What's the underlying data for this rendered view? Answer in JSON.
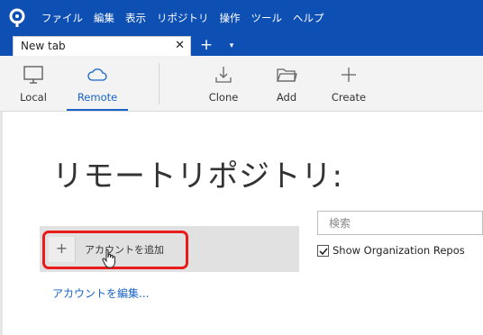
{
  "menubar": {
    "items": [
      "ファイル",
      "編集",
      "表示",
      "リポジトリ",
      "操作",
      "ツール",
      "ヘルプ"
    ]
  },
  "tabs": {
    "active_label": "New tab",
    "close_symbol": "✕",
    "add_symbol": "+",
    "menu_symbol": "▾"
  },
  "toolbar": {
    "local_label": "Local",
    "remote_label": "Remote",
    "clone_label": "Clone",
    "add_label": "Add",
    "create_label": "Create"
  },
  "main": {
    "title": "リモートリポジトリ:",
    "add_account_symbol": "+",
    "add_account_label": "アカウントを追加",
    "edit_accounts_label": "アカウントを編集...",
    "search_placeholder": "検索",
    "org_repos_label": "Show Organization Repos",
    "org_repos_checked": true
  },
  "colors": {
    "brand": "#0d4fb3",
    "accent": "#1863c8",
    "highlight": "#ea1b1b"
  },
  "icons": [
    "app-logo-icon",
    "monitor-icon",
    "cloud-icon",
    "download-tray-icon",
    "folder-icon",
    "plus-icon",
    "check-icon",
    "hand-cursor-icon"
  ]
}
